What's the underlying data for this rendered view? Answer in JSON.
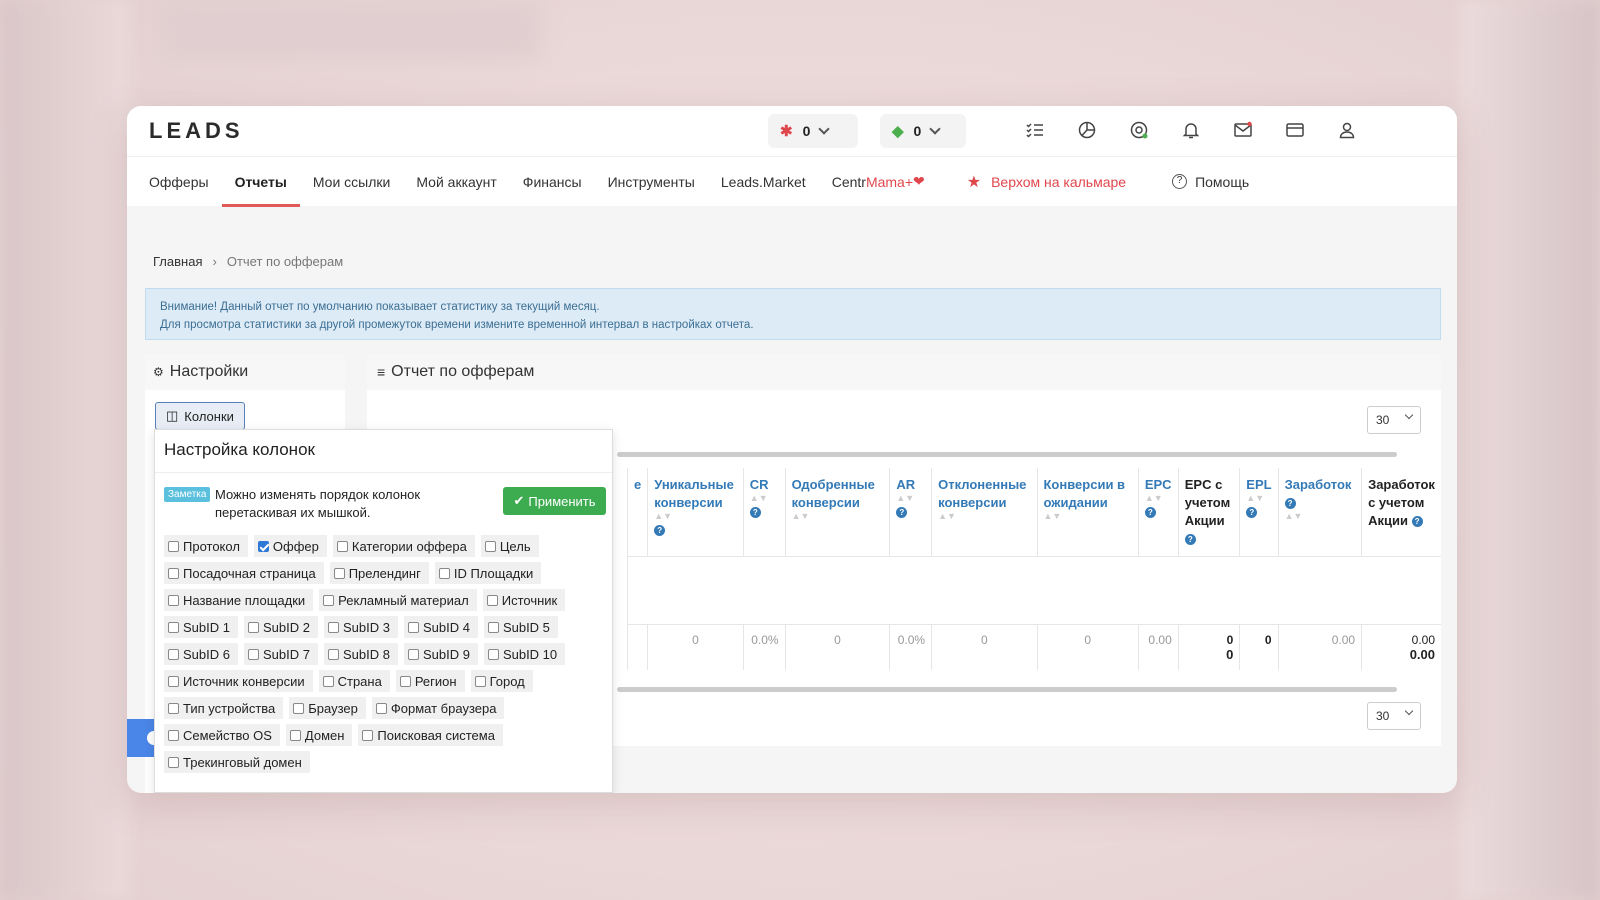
{
  "app": {
    "logo": "LEADS",
    "balance1": "0",
    "balance2": "0"
  },
  "nav": {
    "items": [
      "Офферы",
      "Отчеты",
      "Мои ссылки",
      "Мой аккаунт",
      "Финансы",
      "Инструменты",
      "Leads.Market"
    ],
    "centr_prefix": "Centr",
    "centr_suffix": "Mama+",
    "promo": "Верхом на кальмаре",
    "help": "Помощь",
    "active": "Отчеты"
  },
  "breadcrumb": {
    "home": "Главная",
    "current": "Отчет по офферам"
  },
  "alert": {
    "line1": "Внимание! Данный отчет по умолчанию показывает статистику за текущий месяц.",
    "line2": "Для просмотра статистики за другой промежуток времени измените временной интервал в настройках отчета."
  },
  "settings": {
    "title": "Настройки",
    "columns_button": "Колонки"
  },
  "report": {
    "title": "Отчет по офферам",
    "per_page_top": "30",
    "per_page_bottom": "30",
    "headers": [
      "е",
      "Уникальные конверсии",
      "CR",
      "Одобренные конверсии",
      "AR",
      "Отклоненные конверсии",
      "Конверсии в ожидании",
      "EPC",
      "EPC с учетом Акции",
      "EPL",
      "Заработок",
      "Заработок с учетом Акции"
    ],
    "row": [
      "",
      "0",
      "0.0%",
      "0",
      "0.0%",
      "0",
      "0",
      "0.00",
      "0",
      "0",
      "0.00",
      "0.00"
    ],
    "row_extra": {
      "epc_promo": "0",
      "earn_promo": "0.00"
    }
  },
  "popup": {
    "title": "Настройка колонок",
    "note_badge": "Заметка",
    "note_text": "Можно изменять порядок колонок перетаскивая их мышкой.",
    "apply": "Применить",
    "rows": [
      [
        {
          "label": "Протокол",
          "checked": false
        },
        {
          "label": "Оффер",
          "checked": true
        },
        {
          "label": "Категории оффера",
          "checked": false
        },
        {
          "label": "Цель",
          "checked": false
        }
      ],
      [
        {
          "label": "Посадочная страница",
          "checked": false
        },
        {
          "label": "Прелендинг",
          "checked": false
        },
        {
          "label": "ID Площадки",
          "checked": false
        }
      ],
      [
        {
          "label": "Название площадки",
          "checked": false
        },
        {
          "label": "Рекламный материал",
          "checked": false
        },
        {
          "label": "Источник",
          "checked": false
        }
      ],
      [
        {
          "label": "SubID 1",
          "checked": false
        },
        {
          "label": "SubID 2",
          "checked": false
        },
        {
          "label": "SubID 3",
          "checked": false
        },
        {
          "label": "SubID 4",
          "checked": false
        },
        {
          "label": "SubID 5",
          "checked": false
        }
      ],
      [
        {
          "label": "SubID 6",
          "checked": false
        },
        {
          "label": "SubID 7",
          "checked": false
        },
        {
          "label": "SubID 8",
          "checked": false
        },
        {
          "label": "SubID 9",
          "checked": false
        },
        {
          "label": "SubID 10",
          "checked": false
        }
      ],
      [
        {
          "label": "Источник конверсии",
          "checked": false
        },
        {
          "label": "Страна",
          "checked": false
        },
        {
          "label": "Регион",
          "checked": false
        },
        {
          "label": "Город",
          "checked": false
        }
      ],
      [
        {
          "label": "Тип устройства",
          "checked": false
        },
        {
          "label": "Браузер",
          "checked": false
        },
        {
          "label": "Формат браузера",
          "checked": false
        }
      ],
      [
        {
          "label": "Семейство OS",
          "checked": false
        },
        {
          "label": "Домен",
          "checked": false
        },
        {
          "label": "Поисковая система",
          "checked": false
        }
      ],
      [
        {
          "label": "Трекинговый домен",
          "checked": false
        }
      ]
    ]
  },
  "colors": {
    "accent": "#e0474c",
    "link": "#337ab7",
    "apply": "#3dab50",
    "alert_bg": "#dcebf6"
  },
  "icons": [
    "tasks-icon",
    "pie-chart-icon",
    "support-icon",
    "bell-icon",
    "mail-icon",
    "card-icon",
    "user-icon"
  ]
}
